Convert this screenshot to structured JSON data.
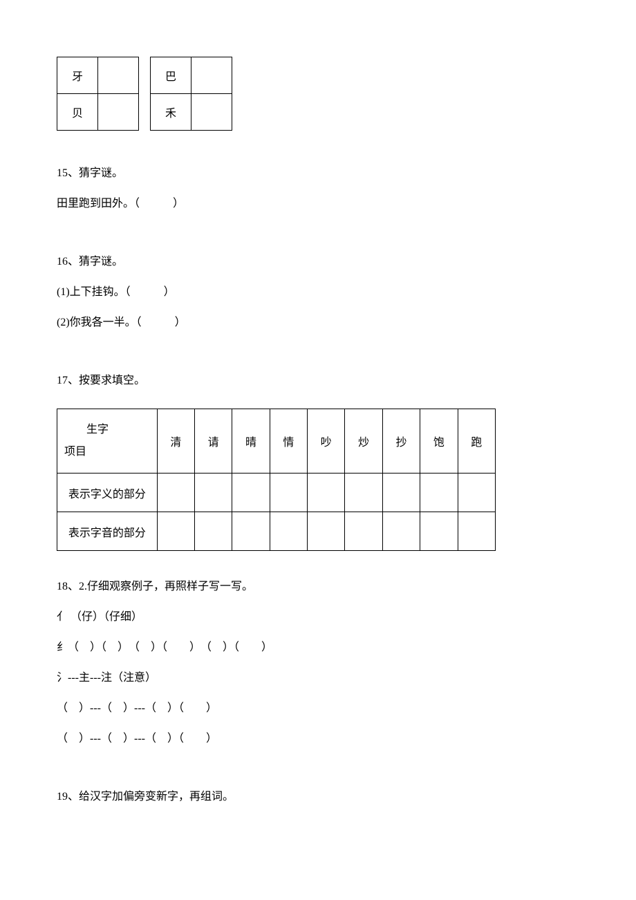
{
  "small_table": {
    "r1c1": "牙",
    "r1c2": "巴",
    "r2c1": "贝",
    "r2c2": "禾"
  },
  "q15": {
    "title": "15、猜字谜。",
    "line1": "田里跑到田外。（　　　）"
  },
  "q16": {
    "title": "16、猜字谜。",
    "line1": "(1)上下挂钩。（　　　）",
    "line2": "(2)你我各一半。（　　　）"
  },
  "q17": {
    "title": "17、按要求填空。",
    "table": {
      "hdr_top": "生字",
      "hdr_bot": "项目",
      "cols": [
        "清",
        "请",
        "晴",
        "情",
        "吵",
        "炒",
        "抄",
        "饱",
        "跑"
      ],
      "row1_label": "表示字义的部分",
      "row2_label": "表示字音的部分"
    }
  },
  "q18": {
    "title": "18、2.仔细观察例子，再照样子写一写。",
    "l1": "亻 （仔）（仔细）",
    "l2": "纟（　）（　）　（　）（　　）　（　）（　　）",
    "l3": "氵---主---注（注意）",
    "l4": "（　）---（　）---（　）（　　）",
    "l5": "（　）---（　）---（　）（　　）"
  },
  "q19": {
    "title": "19、给汉字加偏旁变新字，再组词。"
  }
}
